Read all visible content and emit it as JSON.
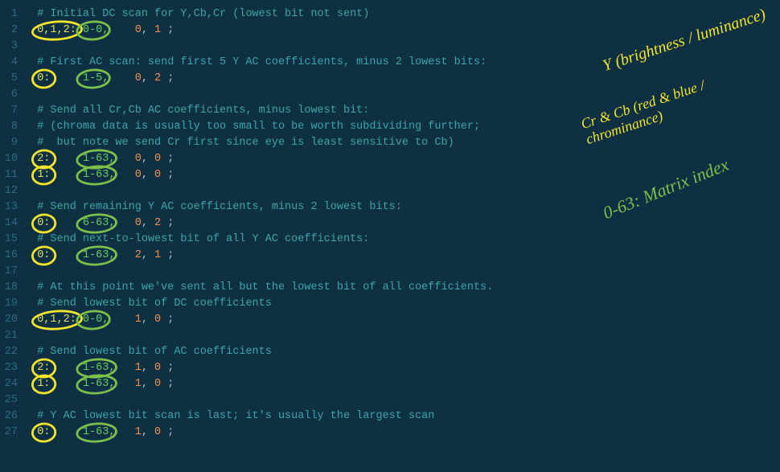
{
  "lines": [
    {
      "n": 1,
      "type": "comment",
      "text": "# Initial DC scan for Y,Cb,Cr (lowest bit not sent)"
    },
    {
      "n": 2,
      "type": "scan",
      "comp": "0,1,2:",
      "range": "0-0,",
      "a": "0",
      "b": "1",
      "circleComp": "yellow",
      "circleRange": "green"
    },
    {
      "n": 3,
      "type": "blank"
    },
    {
      "n": 4,
      "type": "comment",
      "text": "# First AC scan: send first 5 Y AC coefficients, minus 2 lowest bits:"
    },
    {
      "n": 5,
      "type": "scan",
      "comp": "0:",
      "range": "1-5,",
      "a": "0",
      "b": "2",
      "circleComp": "yellow",
      "circleRange": "green"
    },
    {
      "n": 6,
      "type": "blank"
    },
    {
      "n": 7,
      "type": "comment",
      "text": "# Send all Cr,Cb AC coefficients, minus lowest bit:"
    },
    {
      "n": 8,
      "type": "comment",
      "text": "# (chroma data is usually too small to be worth subdividing further;"
    },
    {
      "n": 9,
      "type": "comment",
      "text": "#  but note we send Cr first since eye is least sensitive to Cb)"
    },
    {
      "n": 10,
      "type": "scan",
      "comp": "2:",
      "range": "1-63,",
      "a": "0",
      "b": "0",
      "circleComp": "yellow",
      "circleRange": "green"
    },
    {
      "n": 11,
      "type": "scan",
      "comp": "1:",
      "range": "1-63,",
      "a": "0",
      "b": "0",
      "circleComp": "yellow",
      "circleRange": "green"
    },
    {
      "n": 12,
      "type": "blank"
    },
    {
      "n": 13,
      "type": "comment",
      "text": "# Send remaining Y AC coefficients, minus 2 lowest bits:"
    },
    {
      "n": 14,
      "type": "scan",
      "comp": "0:",
      "range": "6-63,",
      "a": "0",
      "b": "2",
      "circleComp": "yellow",
      "circleRange": "green"
    },
    {
      "n": 15,
      "type": "comment",
      "text": "# Send next-to-lowest bit of all Y AC coefficients:"
    },
    {
      "n": 16,
      "type": "scan",
      "comp": "0:",
      "range": "1-63,",
      "a": "2",
      "b": "1",
      "circleComp": "yellow",
      "circleRange": "green"
    },
    {
      "n": 17,
      "type": "blank"
    },
    {
      "n": 18,
      "type": "comment",
      "text": "# At this point we've sent all but the lowest bit of all coefficients."
    },
    {
      "n": 19,
      "type": "comment",
      "text": "# Send lowest bit of DC coefficients"
    },
    {
      "n": 20,
      "type": "scan",
      "comp": "0,1,2:",
      "range": "0-0,",
      "a": "1",
      "b": "0",
      "circleComp": "yellow",
      "circleRange": "green"
    },
    {
      "n": 21,
      "type": "blank"
    },
    {
      "n": 22,
      "type": "comment",
      "text": "# Send lowest bit of AC coefficients"
    },
    {
      "n": 23,
      "type": "scan",
      "comp": "2:",
      "range": "1-63,",
      "a": "1",
      "b": "0",
      "circleComp": "yellow",
      "circleRange": "green"
    },
    {
      "n": 24,
      "type": "scan",
      "comp": "1:",
      "range": "1-63,",
      "a": "1",
      "b": "0",
      "circleComp": "yellow",
      "circleRange": "green"
    },
    {
      "n": 25,
      "type": "blank"
    },
    {
      "n": 26,
      "type": "comment",
      "text": "# Y AC lowest bit scan is last; it's usually the largest scan"
    },
    {
      "n": 27,
      "type": "scan",
      "comp": "0:",
      "range": "1-63,",
      "a": "1",
      "b": "0",
      "circleComp": "yellow",
      "circleRange": "green"
    }
  ],
  "annotations": {
    "y_label": "Y (brightness / luminance)",
    "crcb_label": "Cr & Cb (red & blue / chrominance)",
    "matrix_label": "0-63: Matrix index"
  },
  "colors": {
    "circle_yellow": "#f2e52c",
    "circle_green": "#7cc04a"
  }
}
